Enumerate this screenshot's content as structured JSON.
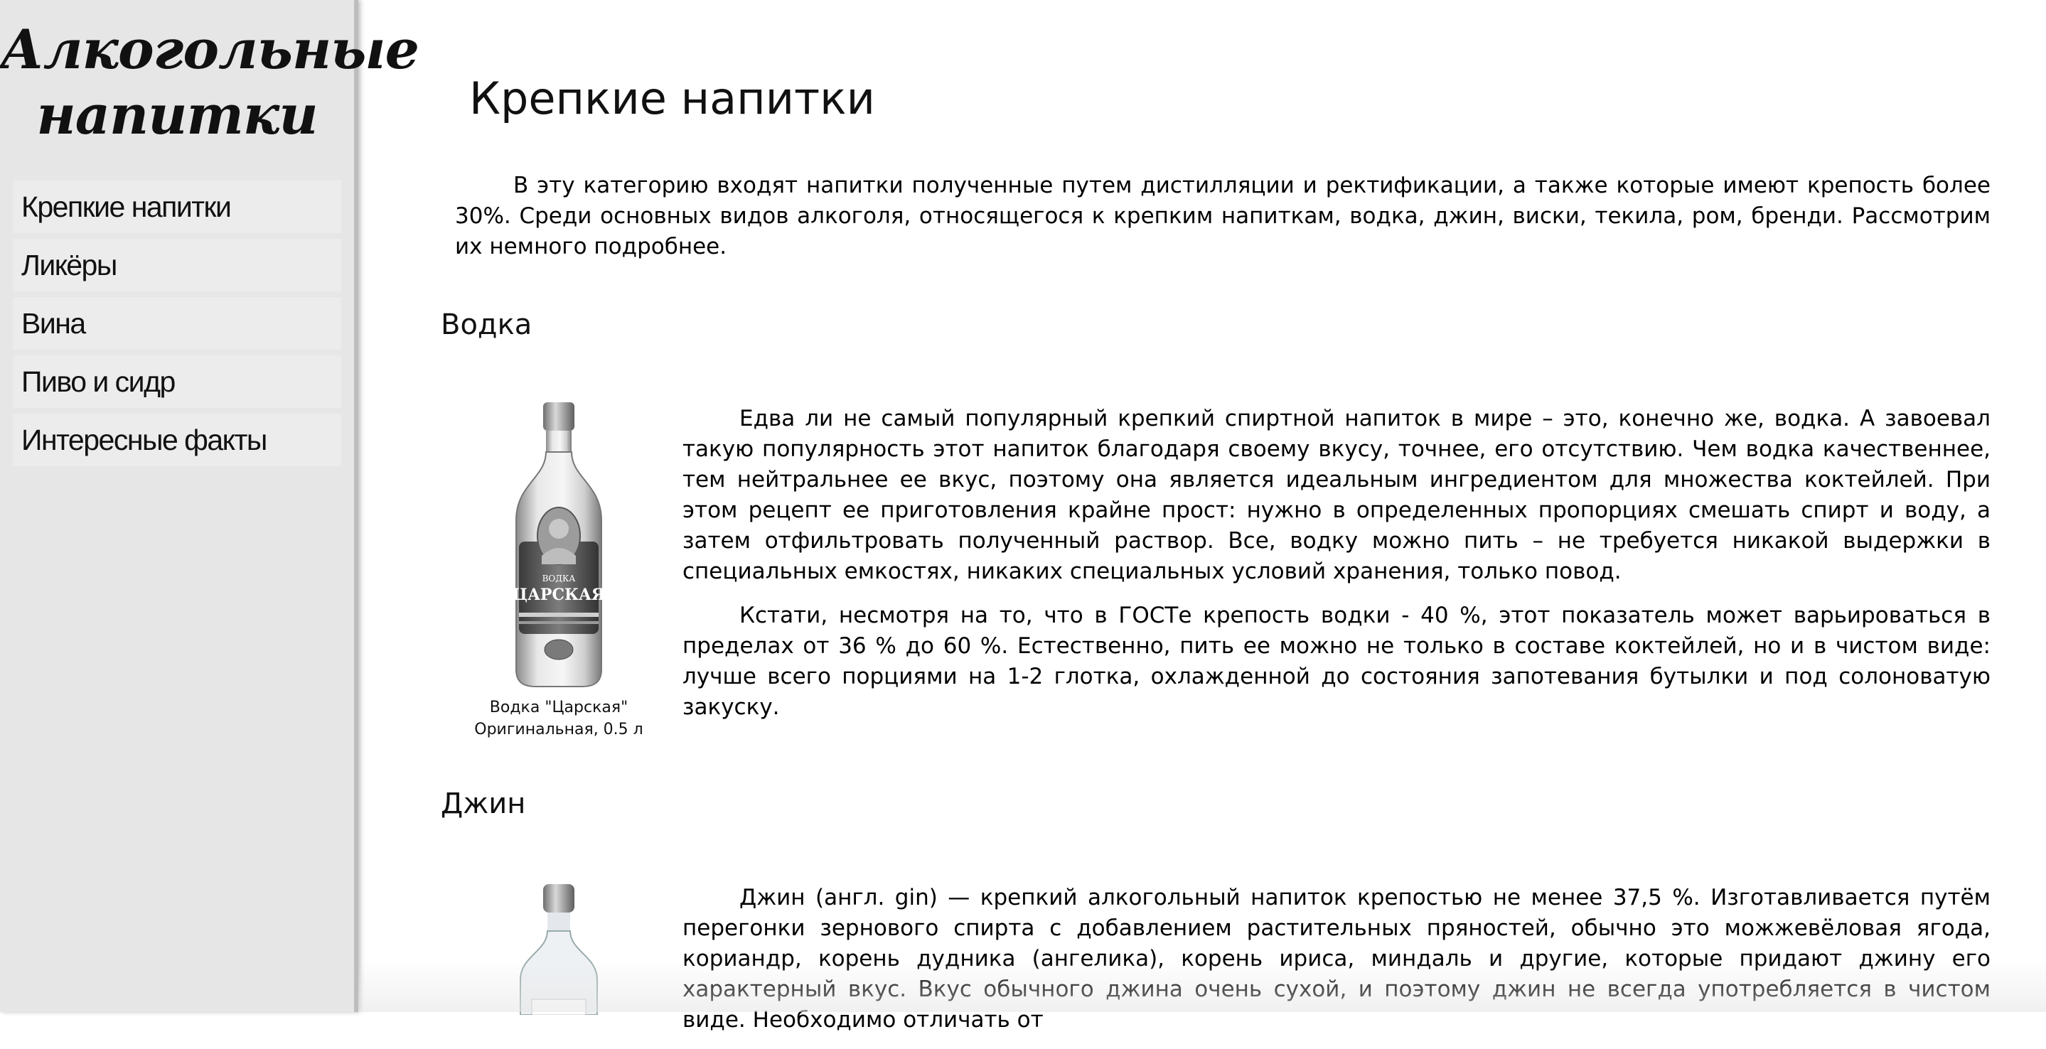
{
  "sidebar": {
    "logo": "Алкогольные напитки",
    "items": [
      {
        "label": "Крепкие напитки"
      },
      {
        "label": "Ликёры"
      },
      {
        "label": "Вина"
      },
      {
        "label": "Пиво и сидр"
      },
      {
        "label": "Интересные факты"
      }
    ]
  },
  "main": {
    "title": "Крепкие напитки",
    "intro": "В эту категорию входят напитки полученные путем дистилляции и ректификации, а также которые имеют крепость более 30%. Среди основных видов алкоголя, относящегося к крепким напиткам, водка, джин, виски, текила, ром, бренди. Рассмотрим их немного подробнее.",
    "sections": [
      {
        "title": "Водка",
        "image_label_top": "ВОДКА",
        "image_label_main": "ЦАРСКАЯ",
        "caption_line1": "Водка \"Царская\"",
        "caption_line2": "Оригинальная, 0.5 л",
        "paragraphs": [
          "Едва ли не самый популярный крепкий спиртной напиток в мире – это, конечно же, водка. А завоевал такую популярность этот напиток благодаря своему вкусу, точнее, его отсутствию. Чем водка качественнее, тем нейтральнее ее вкус, поэтому она является идеальным ингредиентом для множества коктейлей. При этом рецепт ее приготовления крайне прост: нужно в определенных пропорциях смешать спирт и воду, а затем отфильтровать полученный раствор. Все, водку можно пить – не требуется никакой выдержки в специальных емкостях, никаких специальных условий хранения, только повод.",
          "Кстати, несмотря на то, что в ГОСТе крепость водки - 40 %, этот показатель может варьироваться в пределах от 36 % до 60 %. Естественно, пить ее можно не только в составе коктейлей, но и в чистом виде: лучше всего порциями на 1-2 глотка, охлажденной до состояния запотевания бутылки и под солоноватую закуску."
        ]
      },
      {
        "title": "Джин",
        "paragraphs": [
          "Джин (англ. gin) — крепкий алкогольный напиток крепостью не менее 37,5 %. Изготавливается путём перегонки зернового спирта с добавлением растительных пряностей, обычно это можжевёловая ягода, кориандр, корень дудника (ангелика), корень ириса, миндаль и другие, которые придают джину его характерный вкус. Вкус обычного джина очень сухой, и поэтому джин не всегда употребляется в чистом виде. Необходимо отличать от"
        ]
      }
    ]
  }
}
